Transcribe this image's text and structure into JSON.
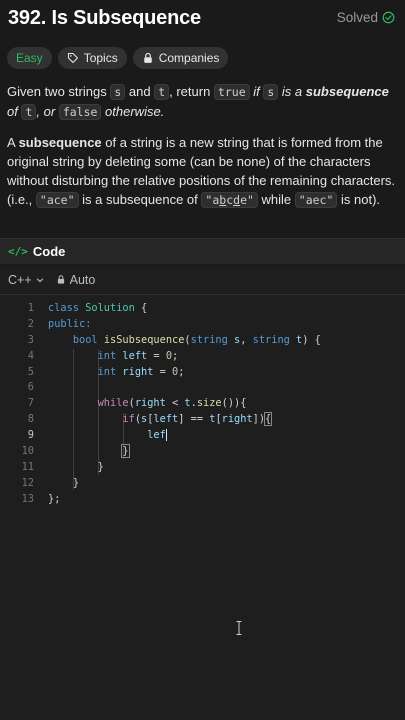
{
  "problem": {
    "title": "392. Is Subsequence",
    "status": "Solved",
    "tags": [
      "Easy",
      "Topics",
      "Companies"
    ]
  },
  "description": {
    "p1": {
      "a": "Given two strings ",
      "s": "s",
      "b": " and ",
      "t": "t",
      "c": ", return ",
      "true": "true",
      "d": " if ",
      "s2": "s",
      "e": " is a ",
      "subsequence": "subsequence",
      "f": " of ",
      "t2": "t",
      "g": ", or ",
      "false": "false",
      "h": " otherwise."
    },
    "p2": {
      "a": "A ",
      "subsequence": "subsequence",
      "b": " of a string is a new string that is formed from the original string by deleting some (can be none) of the characters without disturbing the relative positions of the remaining characters. (i.e., ",
      "ace": "\"ace\"",
      "c": " is a subsequence of ",
      "abcde_pre": "\"a",
      "abcde_b": "b",
      "abcde_c": "c",
      "abcde_d": "d",
      "abcde_post": "e\"",
      "d": " while ",
      "aec": "\"aec\"",
      "e": " is not)."
    }
  },
  "code_panel": {
    "tab_label": "Code",
    "language": "C++",
    "mode": "Auto"
  },
  "code_lines": [
    {
      "n": "1"
    },
    {
      "n": "2"
    },
    {
      "n": "3"
    },
    {
      "n": "4"
    },
    {
      "n": "5"
    },
    {
      "n": "6"
    },
    {
      "n": "7"
    },
    {
      "n": "8"
    },
    {
      "n": "9"
    },
    {
      "n": "10"
    },
    {
      "n": "11"
    },
    {
      "n": "12"
    },
    {
      "n": "13"
    }
  ],
  "code": {
    "l1_kw": "class",
    "l1_name": "Solution",
    "l1_rest": " {",
    "l2": "public:",
    "l3_kw": "bool",
    "l3_fn": "isSubsequence",
    "l3_p1": "(",
    "l3_t1": "string",
    "l3_v1": " s",
    "l3_p2": ", ",
    "l3_t2": "string",
    "l3_v2": " t",
    "l3_p3": ") {",
    "l4_kw": "int",
    "l4_v": " left",
    "l4_eq": " = ",
    "l4_n": "0",
    "l4_end": ";",
    "l5_kw": "int",
    "l5_v": " right",
    "l5_eq": " = ",
    "l5_n": "0",
    "l5_end": ";",
    "l7_kw": "while",
    "l7_a": "(",
    "l7_v": "right",
    "l7_b": " < ",
    "l7_c": "t",
    "l7_d": ".",
    "l7_fn": "size",
    "l7_e": "()){",
    "l8_kw": "if",
    "l8_a": "(",
    "l8_v1": "s",
    "l8_b": "[",
    "l8_v2": "left",
    "l8_c": "] == ",
    "l8_v3": "t",
    "l8_d": "[",
    "l8_v4": "right",
    "l8_e": "])",
    "l8_f": "{",
    "l9": "lef",
    "l10": "}",
    "l11": "}",
    "l12": "}",
    "l13": "};"
  }
}
